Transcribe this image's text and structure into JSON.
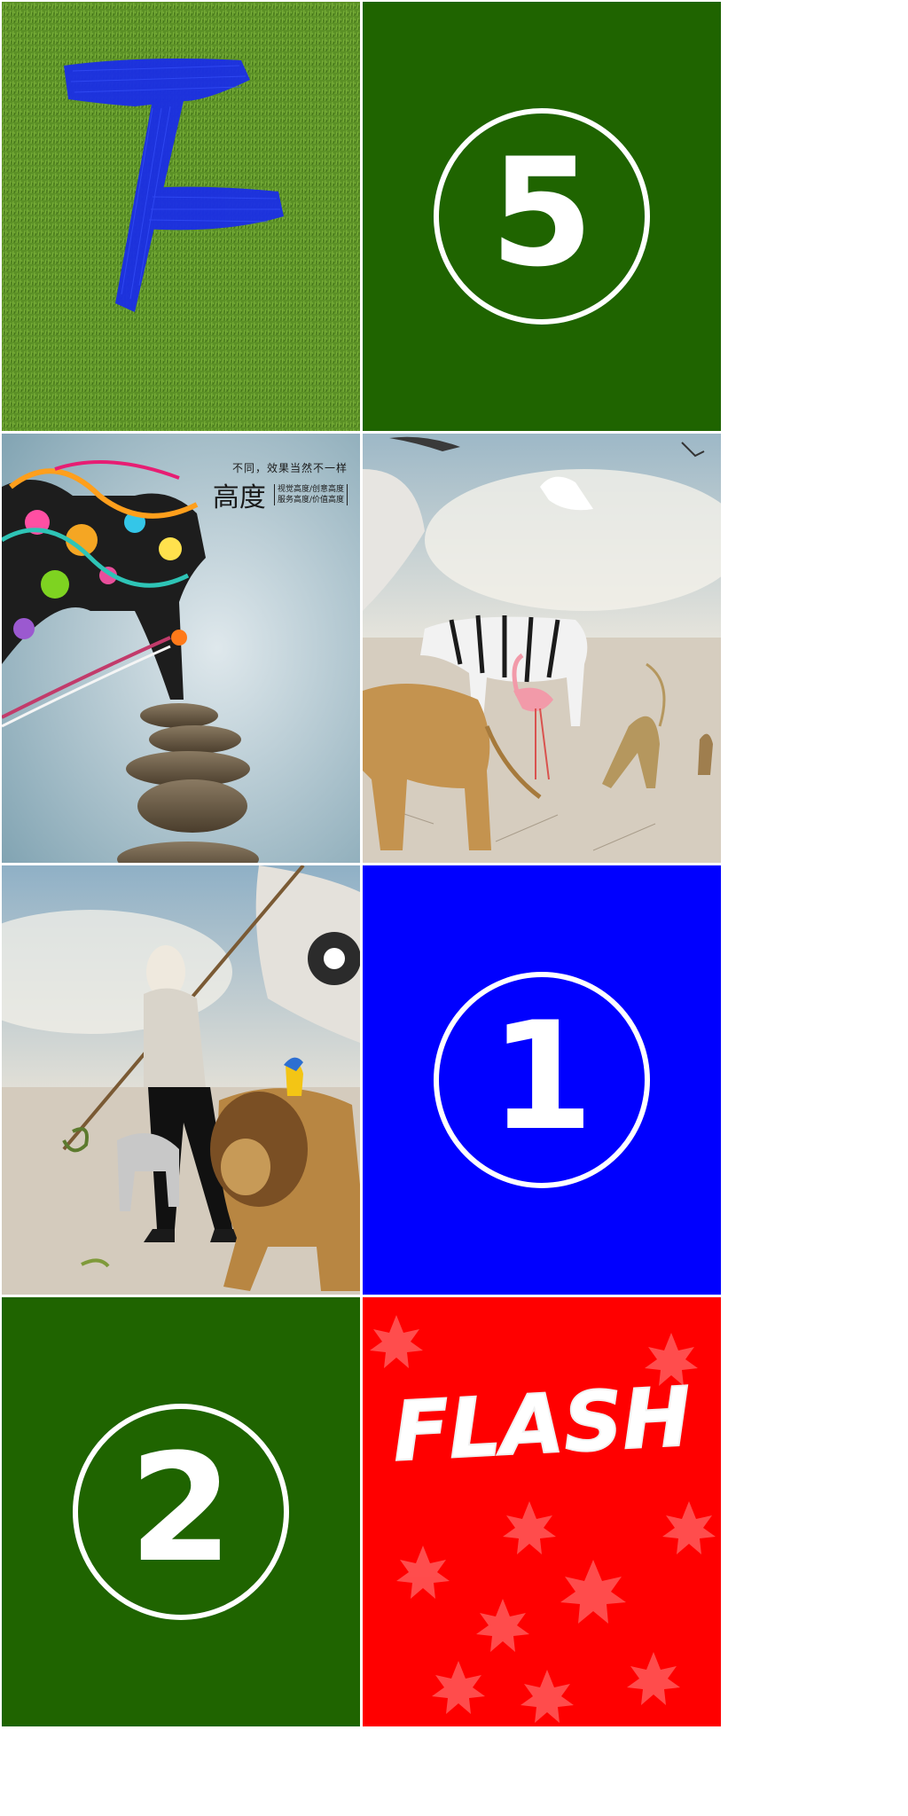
{
  "tiles": {
    "tile_5": {
      "number": "5",
      "background": "#1f6400"
    },
    "tile_1": {
      "number": "1",
      "background": "#0000ff"
    },
    "tile_2": {
      "number": "2",
      "background": "#1f6400"
    },
    "flash": {
      "text": "FLASH",
      "background": "#ff0000"
    },
    "grass_letter": {
      "background": "#5a8f22",
      "letter_color": "#1a2ee6"
    },
    "stones_ad": {
      "slogan": "不同，效果当然不一样",
      "brand": "高度",
      "sub_line1": "视觉高度/创意高度",
      "sub_line2": "服务高度/价值高度"
    }
  },
  "colors": {
    "page_background": "#ffffff",
    "white": "#ffffff"
  }
}
